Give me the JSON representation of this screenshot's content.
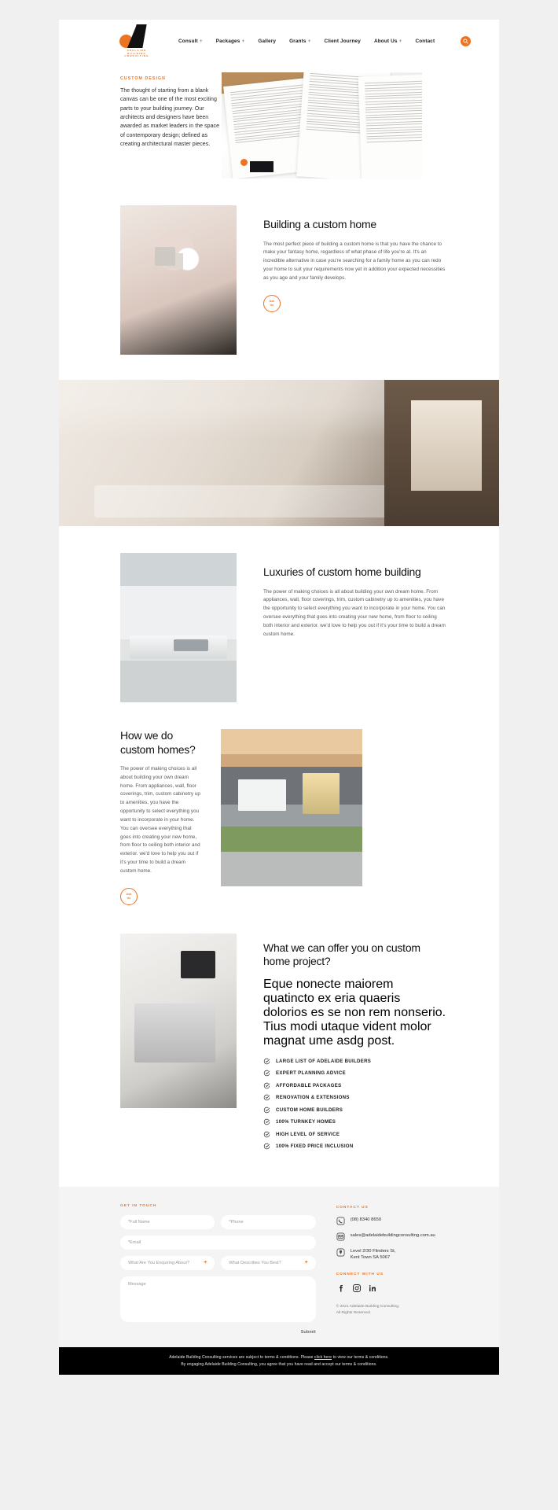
{
  "brand": {
    "logo_lines": [
      "ADELAIDE",
      "BUILDING",
      "CONSULTING"
    ],
    "accent": "#ec7324",
    "dark": "#111111"
  },
  "nav": {
    "items": [
      {
        "label": "Consult",
        "has_plus": true
      },
      {
        "label": "Packages",
        "has_plus": true
      },
      {
        "label": "Gallery",
        "has_plus": false
      },
      {
        "label": "Grants",
        "has_plus": true
      },
      {
        "label": "Client Journey",
        "has_plus": false
      },
      {
        "label": "About Us",
        "has_plus": true
      },
      {
        "label": "Contact",
        "has_plus": false
      }
    ],
    "search_icon": "search-icon"
  },
  "intro": {
    "eyebrow": "CUSTOM DESIGN",
    "body": "The thought of starting from a blank canvas can be one of the most exciting parts to your building journey. Our architects and designers have been awarded as market leaders in the space of contemporary design; defined as creating architectural master pieces."
  },
  "section_custom_home": {
    "title": "Building a custom home",
    "body": "The most perfect piece of building a custom home is that you have the chance to make your fantasy home, regardless of what phase of life you're at. It's an incredible alternative in case you're searching for a family home as you can redo your home to suit your requirements now yet in addition your expected necessities as you age and your family develops.",
    "badge_line1": "Ask",
    "badge_line2": "Us"
  },
  "section_luxuries": {
    "title": "Luxuries of custom home building",
    "body": "The power of making choices is all about building your own dream home. From appliances, wall, floor coverings, trim, custom cabinetry up to amenities, you have the opportunity to select everything you want to incorporate in your home. You can oversee everything that goes into creating your new home, from floor to ceiling both interior and exterior. we'd love to help you out if it's your time to build a dream custom home."
  },
  "section_howwedo": {
    "title": "How we do custom homes?",
    "body": "The power of making choices is all about building your own dream home. From appliances, wall, floor coverings, trim, custom cabinetry up to amenities, you have the opportunity to select everything you want to incorporate in your home. You can oversee everything that goes into creating your new home, from floor to ceiling both interior and exterior. we'd love to help you out if it's your time to build a dream custom home.",
    "badge_line1": "Ask",
    "badge_line2": "Us"
  },
  "section_offer": {
    "title": "What we can offer you on custom home project?",
    "body": "Eque nonecte maiorem quatincto ex eria quaeris dolorios es se non rem nonserio. Tius modi utaque vident molor magnat ume asdg post.",
    "checklist": [
      "LARGE LIST OF ADELAIDE BUILDERS",
      "EXPERT PLANNING ADVICE",
      "AFFORDABLE PACKAGES",
      "RENOVATION & EXTENSIONS",
      "CUSTOM HOME BUILDERS",
      "100% TURNKEY HOMES",
      "HIGH LEVEL OF SERVICE",
      "100% FIXED PRICE INCLUSION"
    ]
  },
  "footer": {
    "form_eyebrow": "GET IN TOUCH",
    "fields": {
      "full_name": "*Full Name",
      "phone": "*Phone",
      "email": "*Email",
      "enquiring": "What Are You Enquiring About?",
      "describes": "What Describes You Best?",
      "message": "Message"
    },
    "submit_label": "Submit",
    "contact_eyebrow": "CONTACT US",
    "contact": {
      "phone": "(08) 8340 8650",
      "email": "sales@adelaidebuildingconsulting.com.au",
      "address_line1": "Level 2/30 Flinders St,",
      "address_line2": "Kent Town SA 5067"
    },
    "connect_eyebrow": "CONNECT WITH US",
    "socials": [
      "facebook-icon",
      "instagram-icon",
      "linkedin-icon"
    ],
    "copyright_line1": "© 2021 Adelaide Building Consulting.",
    "copyright_line2": "All Rights Reserved."
  },
  "bottom_bar": {
    "line1_pre": "Adelaide Building Consulting services are subject to terms & conditions. Please ",
    "line1_link": "click here",
    "line1_post": " to view our terms & conditions.",
    "line2": "By engaging Adelaide Building Consulting, you agree that you have read and accept our terms & conditions."
  }
}
